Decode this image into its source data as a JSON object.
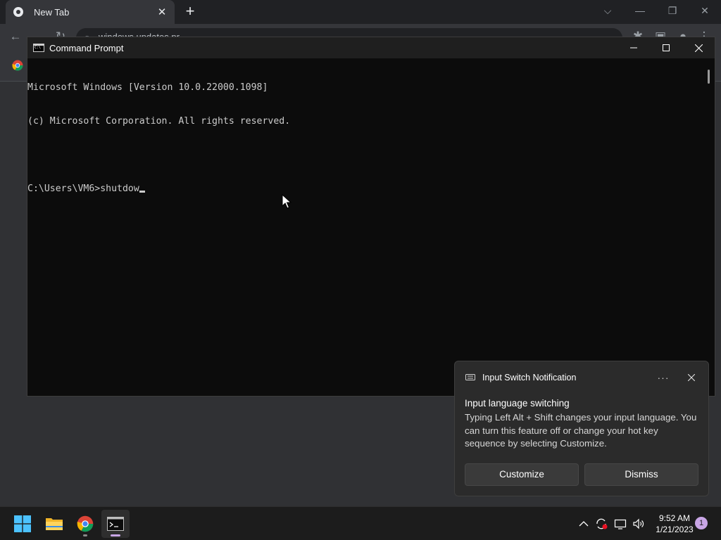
{
  "browser": {
    "tab_title": "New Tab",
    "tab_close_glyph": "✕",
    "new_tab_glyph": "+",
    "address": "windows updates pr",
    "controls": {
      "dropdown": "⌵",
      "minimize": "—",
      "restore": "❐",
      "close": "✕"
    }
  },
  "cmd": {
    "title": "Command Prompt",
    "lines": [
      "Microsoft Windows [Version 10.0.22000.1098]",
      "(c) Microsoft Corporation. All rights reserved.",
      "",
      "C:\\Users\\VM6>shutdow"
    ],
    "background": "#0c0c0c",
    "text_color": "#cccccc"
  },
  "toast": {
    "app_name": "Input Switch Notification",
    "more_glyph": "···",
    "heading": "Input language switching",
    "body": "Typing Left Alt + Shift changes your input language. You can turn this feature off or change your hot key sequence by selecting Customize.",
    "customize_label": "Customize",
    "dismiss_label": "Dismiss"
  },
  "taskbar": {
    "apps": [
      "start-icon",
      "file-explorer-icon",
      "chrome-icon",
      "command-prompt-icon"
    ],
    "tray": {
      "chevron": "^"
    },
    "time": "9:52 AM",
    "date": "1/21/2023",
    "notification_count": "1"
  }
}
